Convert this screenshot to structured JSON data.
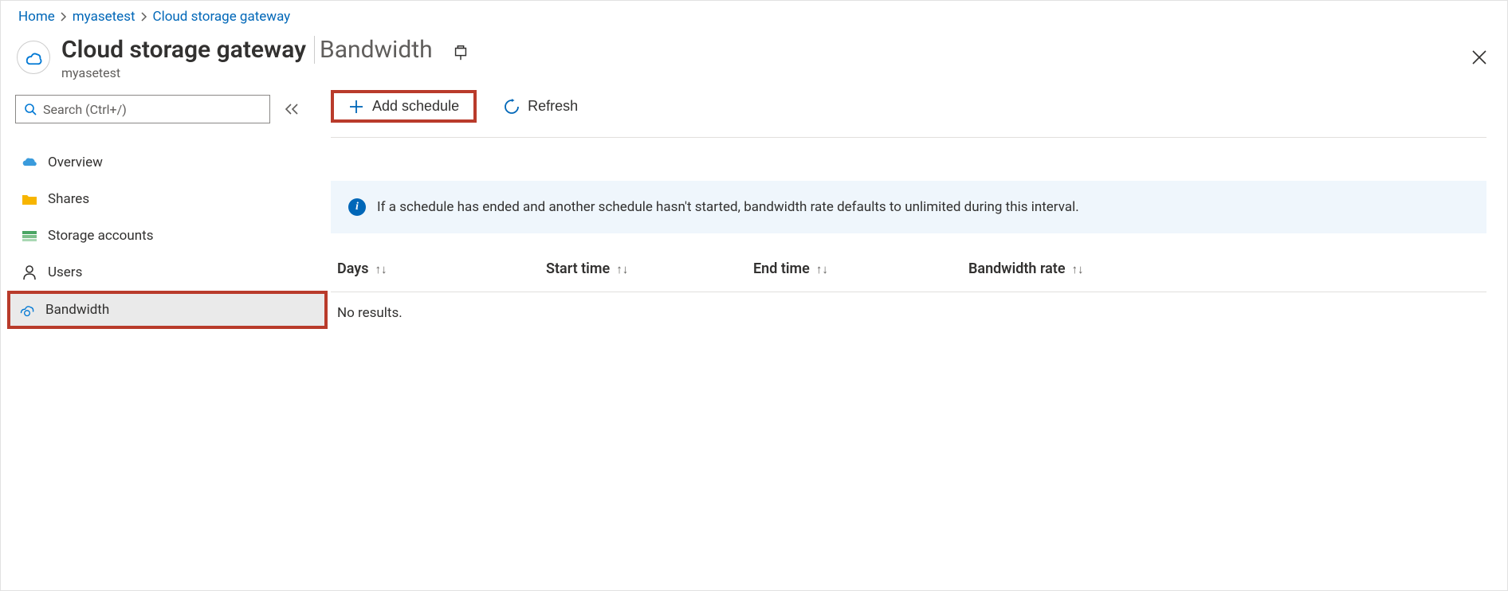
{
  "breadcrumb": {
    "home": "Home",
    "resource": "myasetest",
    "page": "Cloud storage gateway"
  },
  "header": {
    "title_main": "Cloud storage gateway",
    "title_sub": "Bandwidth",
    "subtitle": "myasetest"
  },
  "search": {
    "placeholder": "Search (Ctrl+/)"
  },
  "nav": {
    "overview": "Overview",
    "shares": "Shares",
    "storage": "Storage accounts",
    "users": "Users",
    "bandwidth": "Bandwidth"
  },
  "toolbar": {
    "add_schedule": "Add schedule",
    "refresh": "Refresh"
  },
  "info": {
    "text": "If a schedule has ended and another schedule hasn't started, bandwidth rate defaults to unlimited during this interval."
  },
  "table": {
    "columns": {
      "days": "Days",
      "start": "Start time",
      "end": "End time",
      "rate": "Bandwidth rate"
    },
    "empty": "No results."
  },
  "highlights": {
    "sidebar_active": "bandwidth",
    "toolbar_highlight": "add_schedule"
  }
}
